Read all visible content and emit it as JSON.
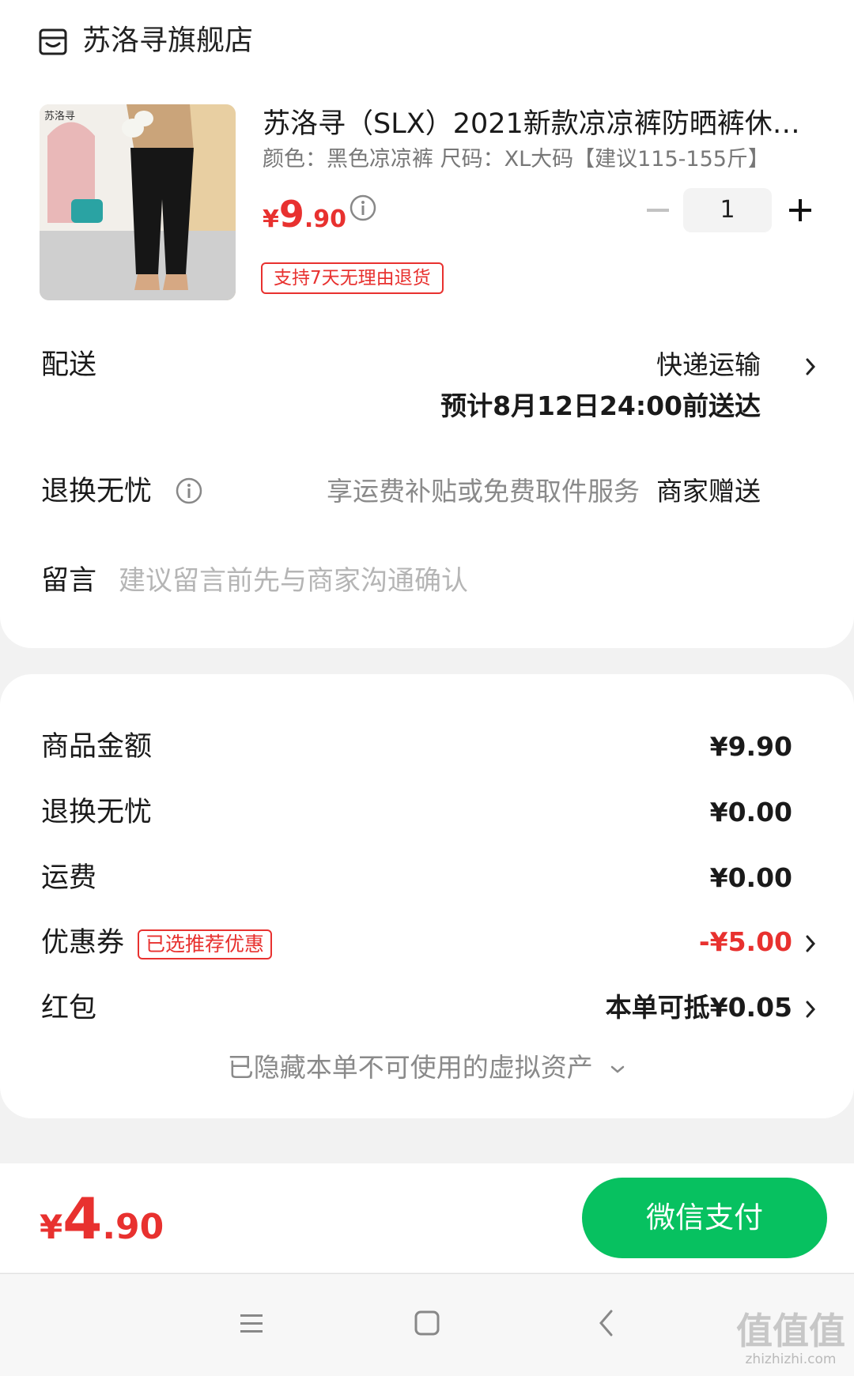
{
  "store": {
    "icon": "store-icon",
    "name": "苏洛寻旗舰店"
  },
  "product": {
    "image_caption": "苏洛寻",
    "title": "苏洛寻（SLX）2021新款凉凉裤防晒裤休闲...",
    "spec": "颜色：黑色凉凉裤    尺码：XL大码【建议115-155斤】",
    "price": {
      "symbol": "¥",
      "integer": "9",
      "decimal": ".90"
    },
    "quantity": "1",
    "return_tag": "支持7天无理由退货"
  },
  "delivery": {
    "label": "配送",
    "method": "快递运输",
    "eta": "预计8月12日24:00前送达"
  },
  "return_service": {
    "label": "退换无忧",
    "desc": "享运费补贴或免费取件服务",
    "provider": "商家赠送"
  },
  "message": {
    "label": "留言",
    "placeholder": "建议留言前先与商家沟通确认"
  },
  "summary": {
    "goods_label": "商品金额",
    "goods_value": "¥9.90",
    "return_label": "退换无忧",
    "return_value": "¥0.00",
    "shipping_label": "运费",
    "shipping_value": "¥0.00",
    "coupon_label": "优惠券",
    "coupon_tag": "已选推荐优惠",
    "coupon_value": "-¥5.00",
    "redpacket_label": "红包",
    "redpacket_value": "本单可抵¥0.05",
    "hidden_assets": "已隐藏本单不可使用的虚拟资产"
  },
  "total": {
    "symbol": "¥",
    "integer": "4",
    "decimal": ".90"
  },
  "pay_button": "微信支付",
  "colors": {
    "accent_red": "#e8312f",
    "wechat_green": "#07c160"
  },
  "watermark": {
    "main": "值值值",
    "domain": "zhizhizhi.com"
  }
}
